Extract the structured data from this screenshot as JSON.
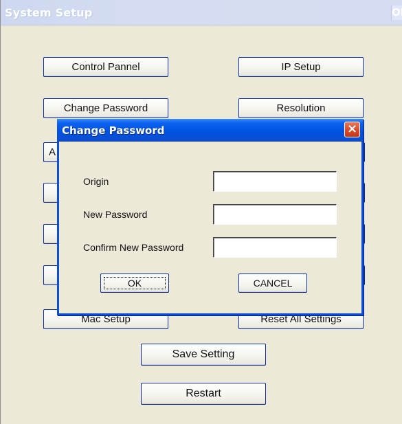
{
  "main_window": {
    "title": "System Setup",
    "corner_button_label": "OK"
  },
  "main_buttons": {
    "control_panel": "Control Pannel",
    "ip_setup": "IP Setup",
    "change_password": "Change Password",
    "resolution": "Resolution",
    "partially_hidden_left": "A",
    "mac_setup": "Mac Setup",
    "reset_all_settings": "Reset All Settings",
    "save_setting": "Save Setting",
    "restart": "Restart"
  },
  "dialog": {
    "title": "Change Password",
    "close_label": "×",
    "fields": [
      {
        "label": "Origin",
        "value": "",
        "placeholder": ""
      },
      {
        "label": "New Password",
        "value": "",
        "placeholder": ""
      },
      {
        "label": "Confirm New Password",
        "value": "",
        "placeholder": ""
      }
    ],
    "ok_label": "OK",
    "cancel_label": "CANCEL"
  },
  "colors": {
    "window_background": "#ece9d8",
    "dialog_accent": "#0054e3",
    "button_border": "#002d96",
    "close_button": "#d74b2c"
  }
}
